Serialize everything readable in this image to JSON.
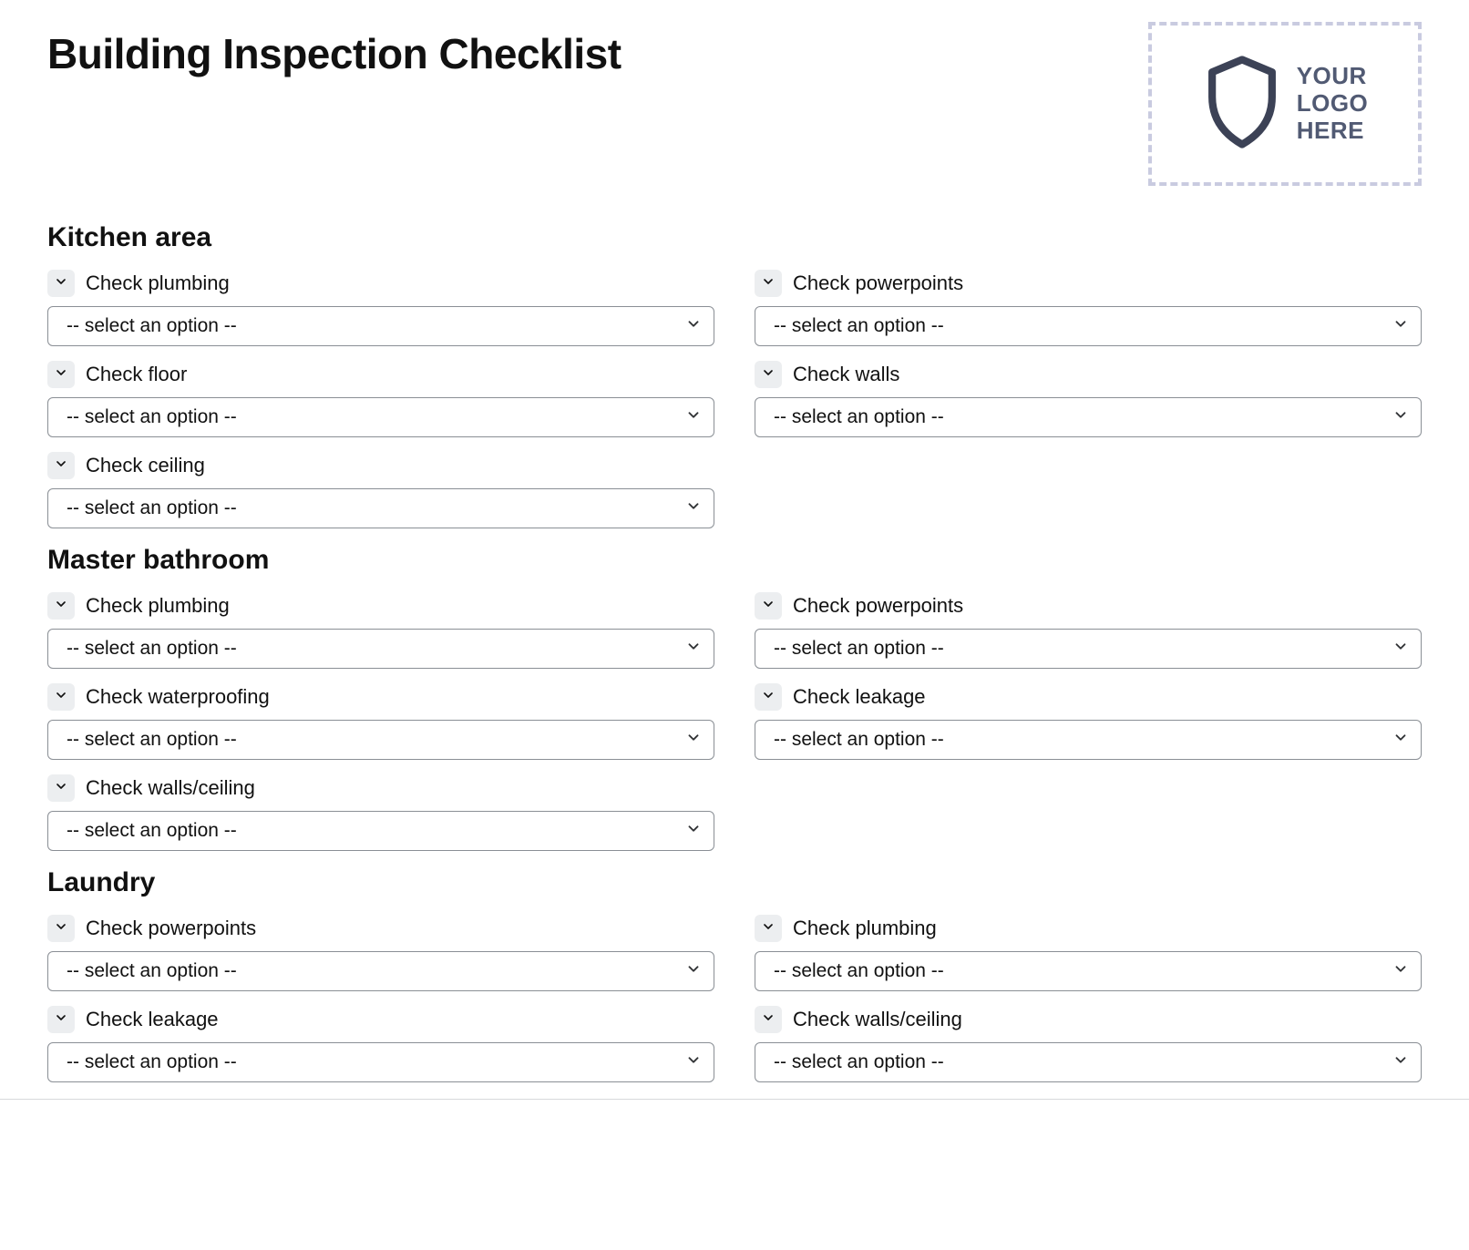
{
  "title": "Building Inspection Checklist",
  "logo_text_lines": [
    "YOUR",
    "LOGO",
    "HERE"
  ],
  "select_placeholder": "-- select an option --",
  "sections": [
    {
      "title": "Kitchen area",
      "items": [
        {
          "label": "Check plumbing"
        },
        {
          "label": "Check powerpoints"
        },
        {
          "label": "Check floor"
        },
        {
          "label": "Check walls"
        },
        {
          "label": "Check ceiling"
        }
      ]
    },
    {
      "title": "Master bathroom",
      "items": [
        {
          "label": "Check plumbing"
        },
        {
          "label": "Check powerpoints"
        },
        {
          "label": "Check waterproofing"
        },
        {
          "label": "Check leakage"
        },
        {
          "label": "Check walls/ceiling"
        }
      ]
    },
    {
      "title": "Laundry",
      "items": [
        {
          "label": "Check powerpoints"
        },
        {
          "label": "Check plumbing"
        },
        {
          "label": "Check leakage"
        },
        {
          "label": "Check walls/ceiling"
        }
      ]
    }
  ]
}
